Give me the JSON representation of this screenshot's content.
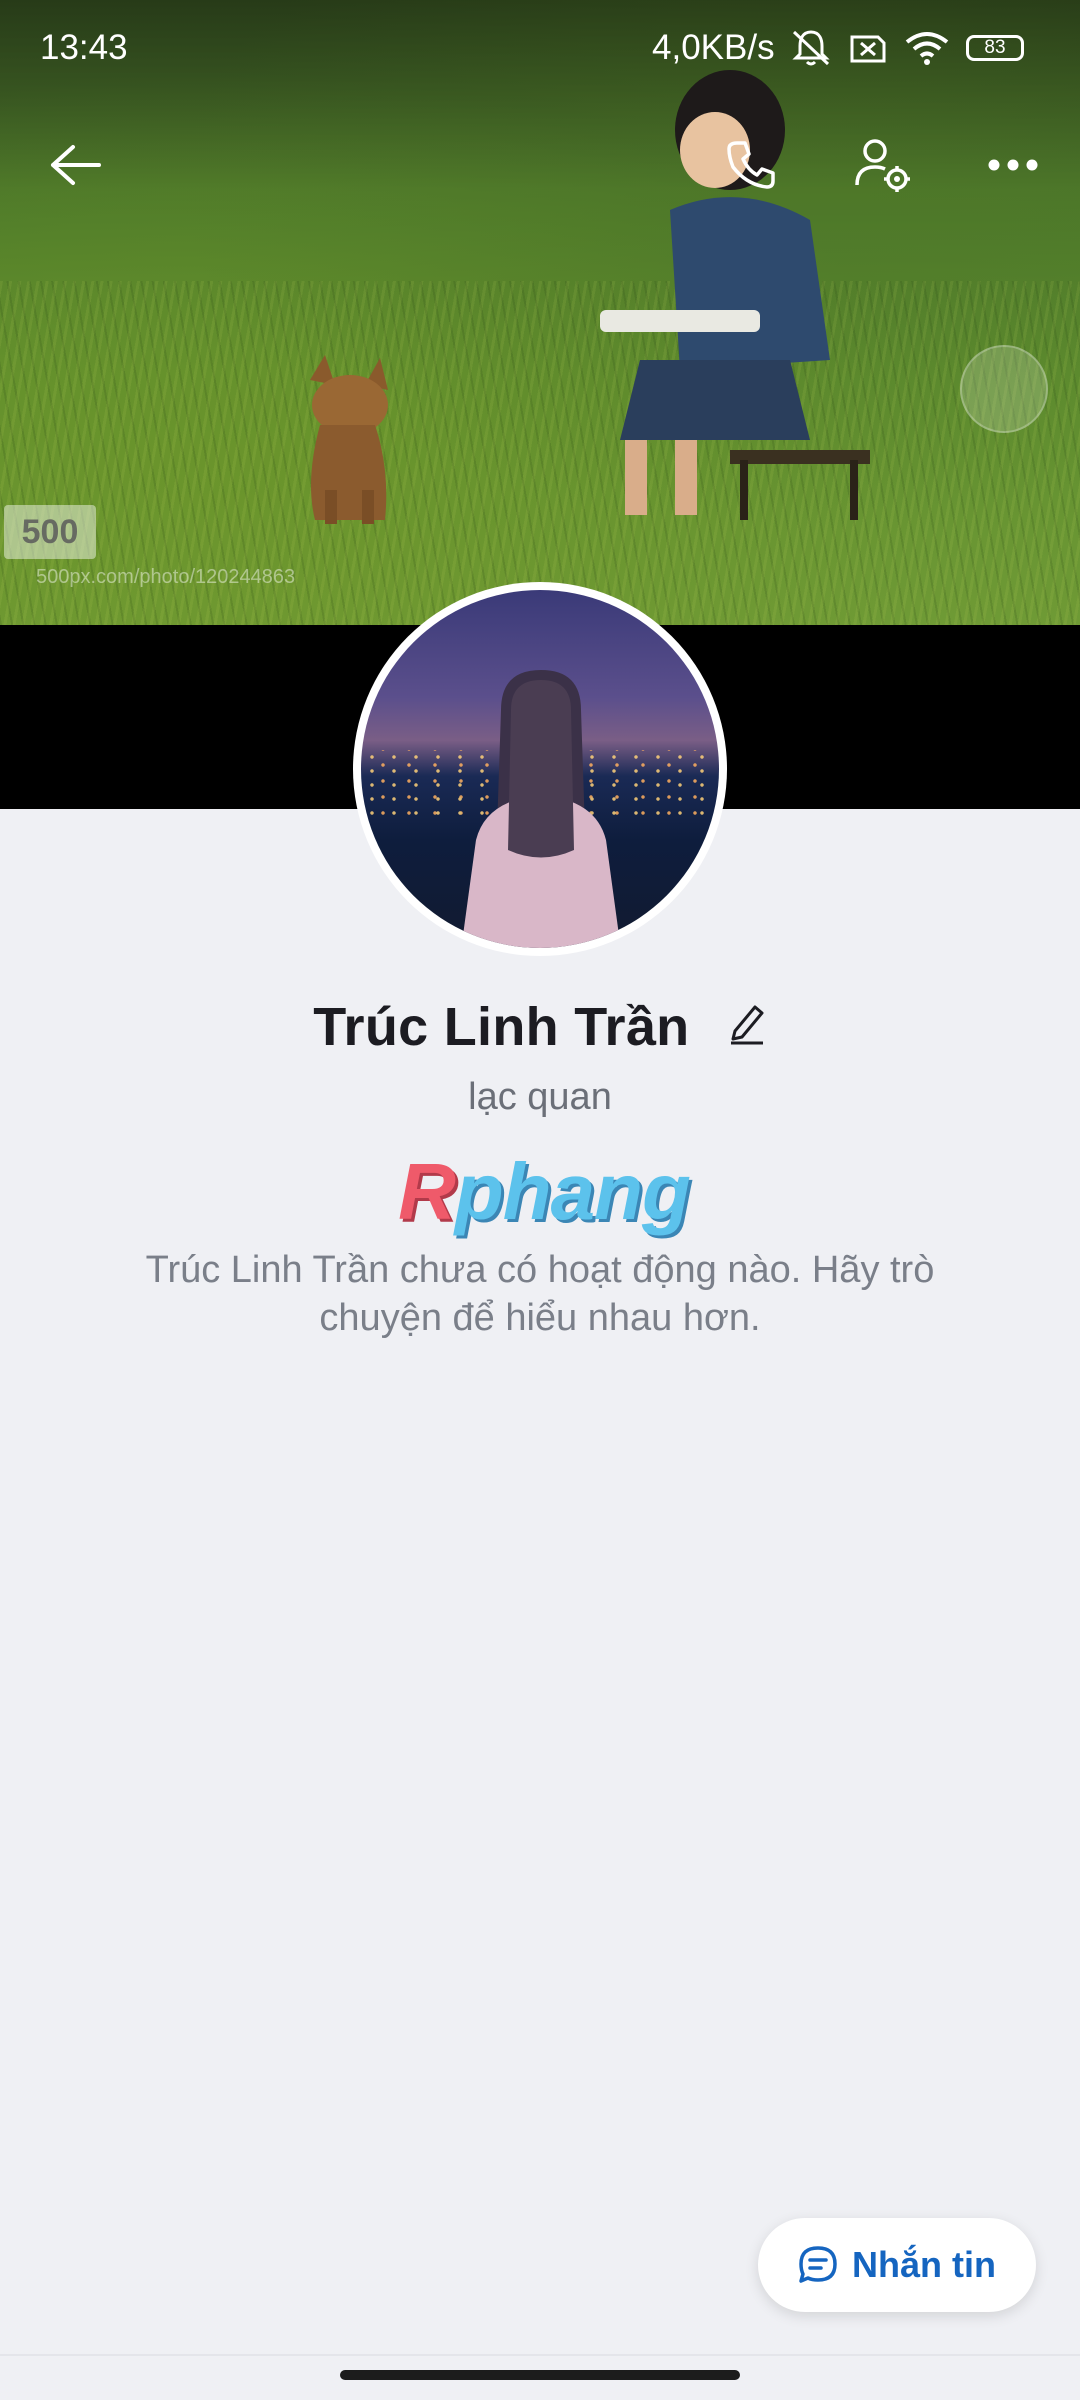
{
  "status_bar": {
    "time": "13:43",
    "network_speed": "4,0KB/s",
    "battery": "83"
  },
  "cover": {
    "watermark_badge": "500",
    "watermark_url": "500px.com/photo/120244863"
  },
  "profile": {
    "name": "Trúc Linh Trần",
    "bio": "lạc quan",
    "empty_activity_message": "Trúc Linh Trần chưa có hoạt động nào. Hãy trò chuyện để hiểu nhau hơn."
  },
  "logo": {
    "first_letter": "R",
    "rest": "phang"
  },
  "actions": {
    "message_label": "Nhắn tin"
  },
  "colors": {
    "accent": "#1565c0",
    "background": "#eff0f4"
  }
}
